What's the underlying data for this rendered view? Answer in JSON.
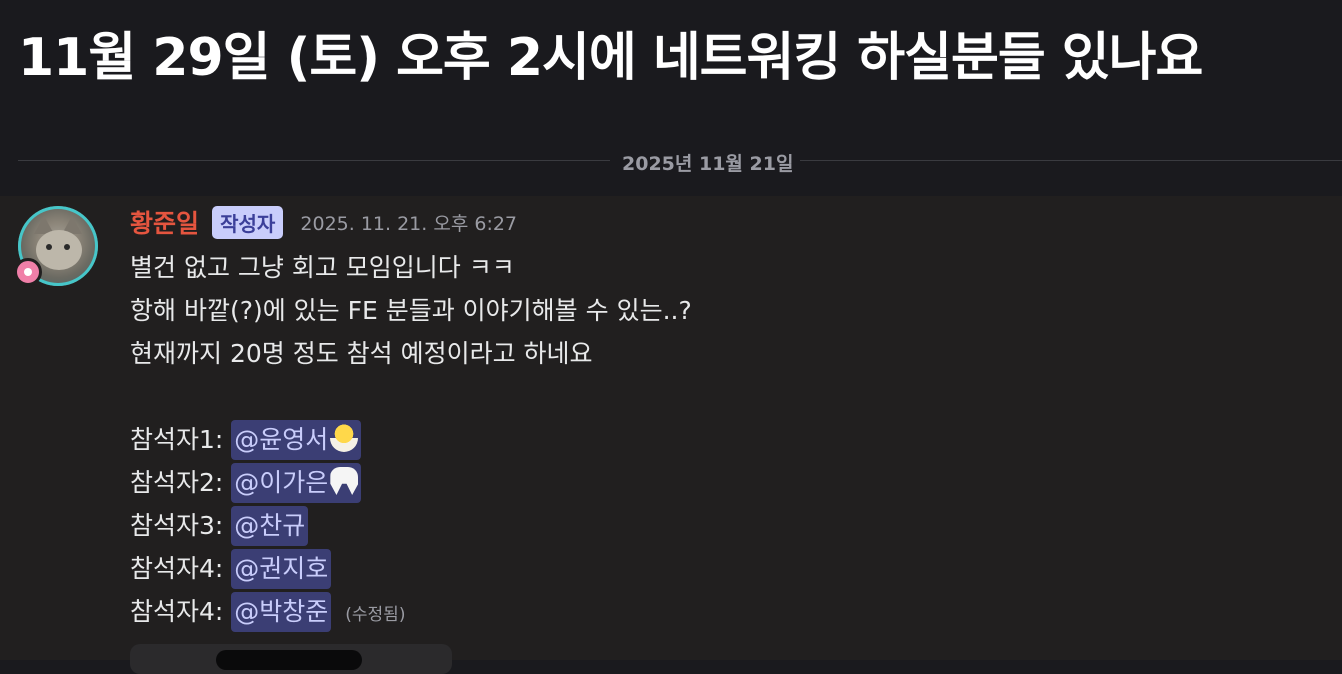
{
  "thread": {
    "title": "11월 29일 (토) 오후 2시에 네트워킹 하실분들 있나요"
  },
  "divider": {
    "date": "2025년 11월 21일"
  },
  "message": {
    "author": "황준일",
    "author_tag": "작성자",
    "timestamp": "2025. 11. 21. 오후 6:27",
    "lines": [
      "별건 없고 그냥 회고 모임입니다 ㅋㅋ",
      "항해 바깥(?)에 있는 FE 분들과 이야기해볼 수 있는..?",
      "현재까지 20명 정도 참석 예정이라고 하네요"
    ],
    "attendees": [
      {
        "label": "참석자1:",
        "mention": "@윤영서",
        "emoji": "hatching-chick-emoji"
      },
      {
        "label": "참석자2:",
        "mention": "@이가은",
        "emoji": "tooth-emoji"
      },
      {
        "label": "참석자3:",
        "mention": "@찬규",
        "emoji": ""
      },
      {
        "label": "참석자4:",
        "mention": "@권지호",
        "emoji": ""
      },
      {
        "label": "참석자4:",
        "mention": "@박창준",
        "emoji": ""
      }
    ],
    "edited_label": "(수정됨)"
  },
  "colors": {
    "author": "#e5553f",
    "author_tag_bg": "#c9cdfb",
    "mention_bg": "#3b3e74",
    "mention_text": "#c9cdfb",
    "avatar_ring": "#46c6c9"
  }
}
